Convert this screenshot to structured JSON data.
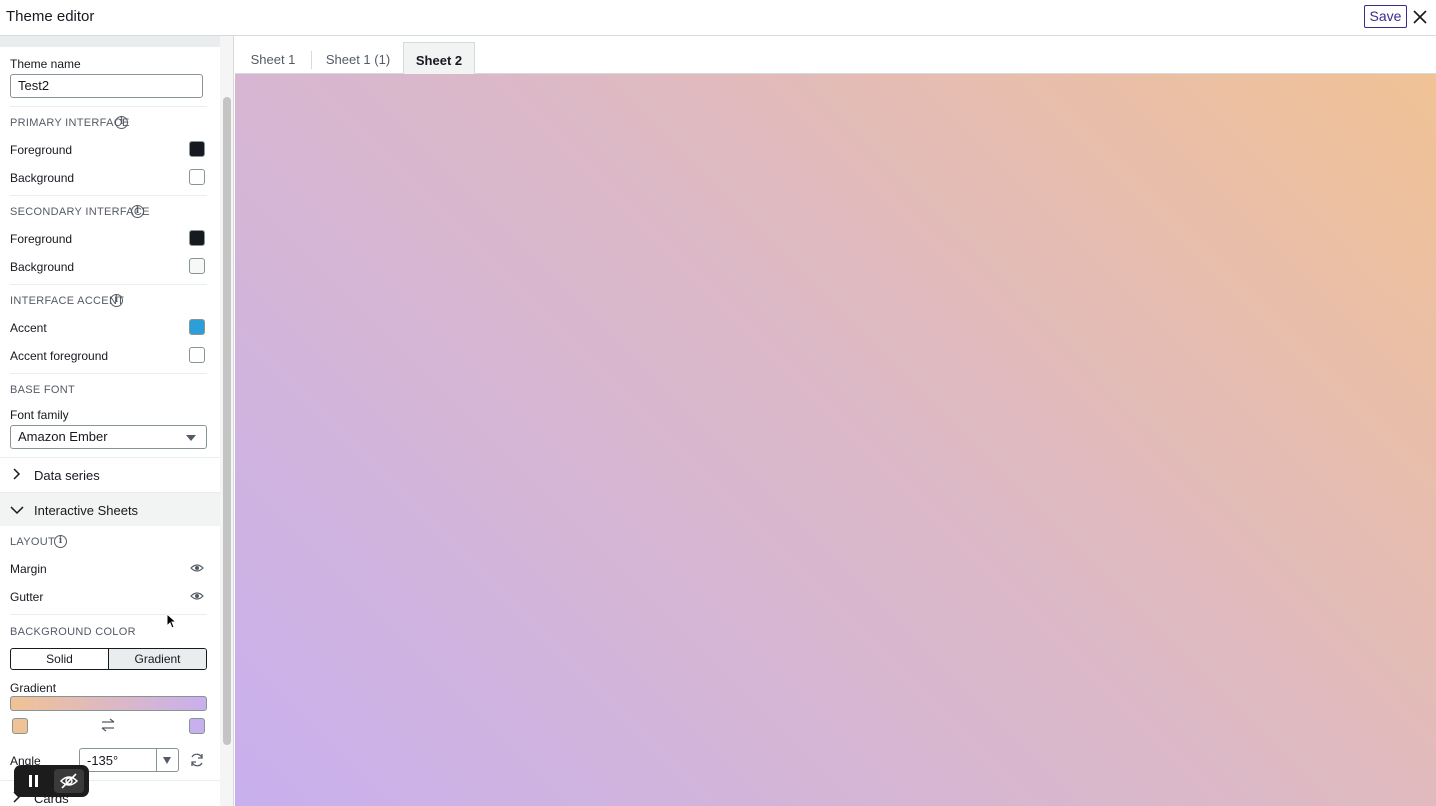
{
  "header": {
    "title": "Theme editor",
    "save_label": "Save",
    "close_icon": "close-icon"
  },
  "sidebar": {
    "theme_name": {
      "label": "Theme name",
      "value": "Test2"
    },
    "primary_interface": {
      "heading": "PRIMARY INTERFACE",
      "foreground": {
        "label": "Foreground",
        "color": "#16191f"
      },
      "background": {
        "label": "Background",
        "color": "#ffffff"
      }
    },
    "secondary_interface": {
      "heading": "SECONDARY INTERFACE",
      "foreground": {
        "label": "Foreground",
        "color": "#16191f"
      },
      "background": {
        "label": "Background",
        "color": "#f7f7f7"
      }
    },
    "interface_accent": {
      "heading": "INTERFACE ACCENT",
      "accent": {
        "label": "Accent",
        "color": "#2d9fd8"
      },
      "accent_foreground": {
        "label": "Accent foreground",
        "color": "#ffffff"
      }
    },
    "base_font": {
      "heading": "BASE FONT",
      "family_label": "Font family",
      "family_value": "Amazon Ember"
    },
    "sections": {
      "data_series": "Data series",
      "interactive_sheets": "Interactive Sheets",
      "cards": "Cards"
    },
    "layout": {
      "heading": "LAYOUT",
      "margin": "Margin",
      "gutter": "Gutter"
    },
    "background_color": {
      "heading": "BACKGROUND COLOR",
      "solid": "Solid",
      "gradient": "Gradient",
      "selected": "Gradient",
      "gradient_label": "Gradient",
      "start_color": "#f1c295",
      "end_color": "#c8b0ee",
      "angle_label": "Angle",
      "angle_value": "-135°"
    }
  },
  "tabs": [
    {
      "label": "Sheet 1",
      "active": false
    },
    {
      "label": "Sheet 1 (1)",
      "active": false
    },
    {
      "label": "Sheet 2",
      "active": true
    }
  ],
  "canvas": {
    "gradient_start": "#f1c295",
    "gradient_end": "#c8b0ee",
    "angle": "-135°"
  }
}
